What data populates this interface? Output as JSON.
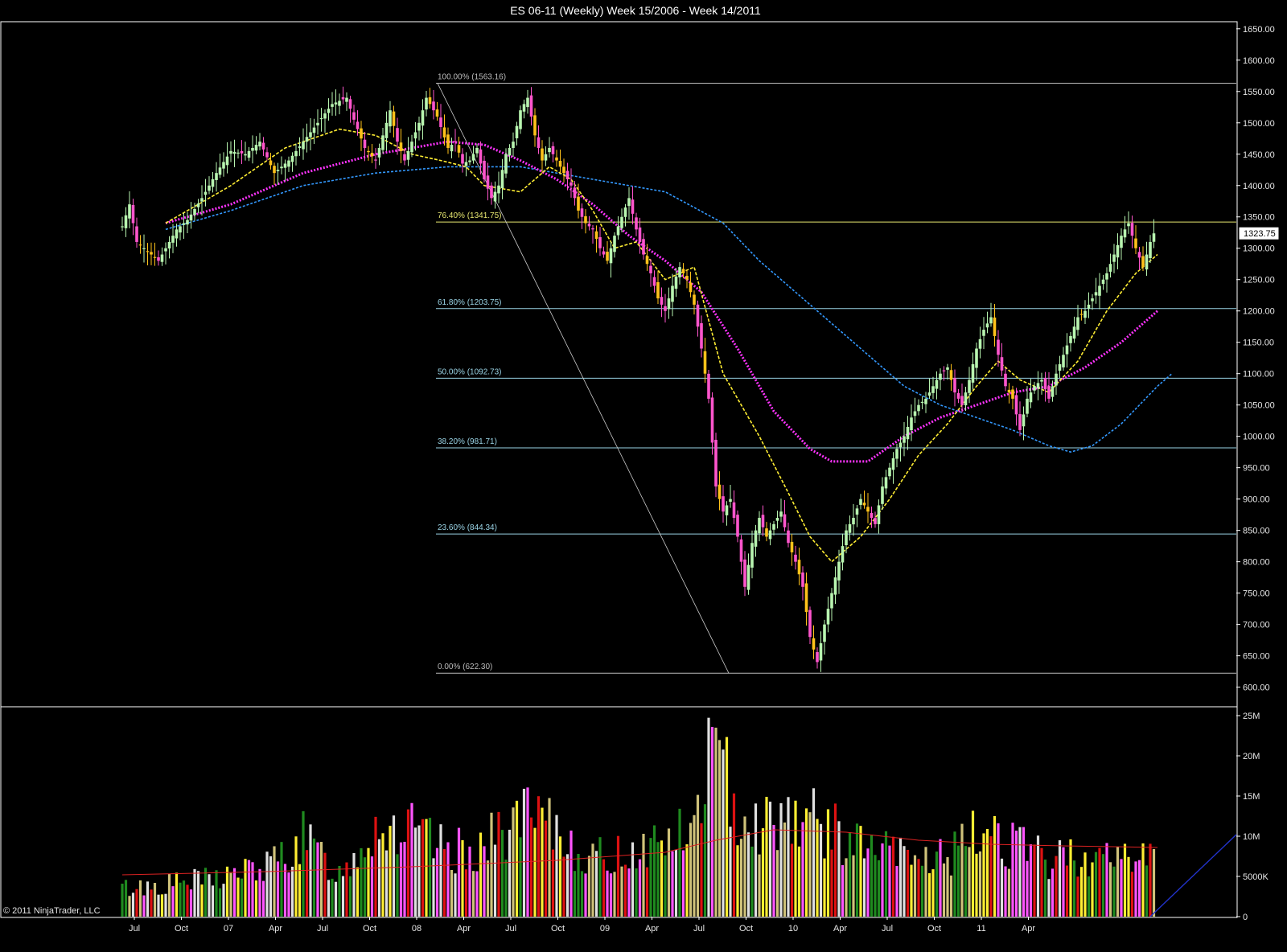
{
  "chart_data": {
    "type": "candlestick",
    "title": "ES 06-11 (Weekly)  Week 15/2006 - Week 14/2011",
    "copyright": "© 2011 NinjaTrader, LLC",
    "last_price": "1323.75",
    "colors": {
      "background": "#000000",
      "grid_frame": "#ffffff",
      "up_candle": "#b8f5b0",
      "down_candle_magenta": "#ff55cc",
      "down_candle_yellow": "#ffc21a",
      "ma_fast": "#ffee33",
      "ma_mid": "#ff33ff",
      "ma_slow": "#3399ff",
      "fib_764": "#e8e870",
      "fib_other": "#9ad4e6",
      "vol_ma": "#dd2222",
      "trendline": "#2233cc"
    },
    "price_panel": {
      "ylim": [
        570,
        1660
      ],
      "ticks": [
        "1650.00",
        "1600.00",
        "1550.00",
        "1500.00",
        "1450.00",
        "1400.00",
        "1350.00",
        "1300.00",
        "1250.00",
        "1200.00",
        "1150.00",
        "1100.00",
        "1050.00",
        "1000.00",
        "950.00",
        "900.00",
        "850.00",
        "800.00",
        "750.00",
        "700.00",
        "650.00",
        "600.00"
      ],
      "tick_values": [
        1650,
        1600,
        1550,
        1500,
        1450,
        1400,
        1350,
        1300,
        1250,
        1200,
        1150,
        1100,
        1050,
        1000,
        950,
        900,
        850,
        800,
        750,
        700,
        650,
        600
      ]
    },
    "volume_panel": {
      "ylim": [
        0,
        26
      ],
      "ticks": [
        "25M",
        "20M",
        "15M",
        "10M",
        "5000K",
        "0"
      ],
      "tick_values": [
        25,
        20,
        15,
        10,
        5,
        0
      ]
    },
    "x_axis": {
      "labels": [
        "Jul",
        "Oct",
        "07",
        "Apr",
        "Jul",
        "Oct",
        "08",
        "Apr",
        "Jul",
        "Oct",
        "09",
        "Apr",
        "Jul",
        "Oct",
        "10",
        "Apr",
        "Jul",
        "Oct",
        "11",
        "Apr"
      ],
      "weeks": [
        -10,
        3,
        16,
        29,
        42,
        55,
        68,
        81,
        94,
        107,
        120,
        133,
        146,
        159,
        172,
        185,
        198,
        211,
        224,
        237
      ]
    },
    "fibonacci": [
      {
        "label": "100.00% (1563.16)",
        "value": 1563.16
      },
      {
        "label": "76.40% (1341.75)",
        "value": 1341.75
      },
      {
        "label": "61.80% (1203.75)",
        "value": 1203.75
      },
      {
        "label": "50.00% (1092.73)",
        "value": 1092.73
      },
      {
        "label": "38.20% (981.71)",
        "value": 981.71
      },
      {
        "label": "23.60% (844.34)",
        "value": 844.34
      },
      {
        "label": "0.00% (622.30)",
        "value": 622.3
      }
    ],
    "close_anchors": [
      [
        0,
        1335
      ],
      [
        2,
        1370
      ],
      [
        4,
        1310
      ],
      [
        6,
        1300
      ],
      [
        8,
        1290
      ],
      [
        10,
        1280
      ],
      [
        12,
        1300
      ],
      [
        15,
        1330
      ],
      [
        18,
        1345
      ],
      [
        22,
        1380
      ],
      [
        26,
        1420
      ],
      [
        30,
        1455
      ],
      [
        34,
        1450
      ],
      [
        38,
        1470
      ],
      [
        42,
        1420
      ],
      [
        46,
        1440
      ],
      [
        50,
        1470
      ],
      [
        54,
        1500
      ],
      [
        58,
        1530
      ],
      [
        62,
        1540
      ],
      [
        64,
        1505
      ],
      [
        67,
        1460
      ],
      [
        70,
        1440
      ],
      [
        72,
        1480
      ],
      [
        74,
        1520
      ],
      [
        76,
        1470
      ],
      [
        78,
        1440
      ],
      [
        80,
        1470
      ],
      [
        82,
        1500
      ],
      [
        84,
        1540
      ],
      [
        87,
        1510
      ],
      [
        90,
        1460
      ],
      [
        92,
        1470
      ],
      [
        94,
        1435
      ],
      [
        96,
        1440
      ],
      [
        98,
        1460
      ],
      [
        100,
        1410
      ],
      [
        102,
        1380
      ],
      [
        104,
        1400
      ],
      [
        106,
        1450
      ],
      [
        108,
        1470
      ],
      [
        110,
        1520
      ],
      [
        112,
        1540
      ],
      [
        114,
        1480
      ],
      [
        116,
        1440
      ],
      [
        118,
        1460
      ],
      [
        120,
        1440
      ],
      [
        122,
        1420
      ],
      [
        124,
        1400
      ],
      [
        126,
        1360
      ],
      [
        128,
        1340
      ],
      [
        130,
        1330
      ],
      [
        132,
        1300
      ],
      [
        134,
        1280
      ],
      [
        136,
        1320
      ],
      [
        138,
        1350
      ],
      [
        140,
        1380
      ],
      [
        142,
        1330
      ],
      [
        144,
        1290
      ],
      [
        146,
        1260
      ],
      [
        148,
        1220
      ],
      [
        150,
        1200
      ],
      [
        152,
        1240
      ],
      [
        154,
        1270
      ],
      [
        156,
        1250
      ],
      [
        158,
        1210
      ],
      [
        160,
        1140
      ],
      [
        162,
        1060
      ],
      [
        164,
        920
      ],
      [
        166,
        880
      ],
      [
        168,
        900
      ],
      [
        170,
        840
      ],
      [
        172,
        760
      ],
      [
        174,
        830
      ],
      [
        176,
        870
      ],
      [
        178,
        840
      ],
      [
        180,
        860
      ],
      [
        182,
        880
      ],
      [
        184,
        830
      ],
      [
        186,
        800
      ],
      [
        188,
        760
      ],
      [
        190,
        680
      ],
      [
        192,
        640
      ],
      [
        194,
        700
      ],
      [
        196,
        750
      ],
      [
        198,
        800
      ],
      [
        200,
        850
      ],
      [
        202,
        870
      ],
      [
        204,
        900
      ],
      [
        206,
        880
      ],
      [
        208,
        860
      ],
      [
        210,
        920
      ],
      [
        212,
        950
      ],
      [
        214,
        980
      ],
      [
        216,
        1000
      ],
      [
        218,
        1030
      ],
      [
        220,
        1050
      ],
      [
        222,
        1060
      ],
      [
        224,
        1080
      ],
      [
        226,
        1100
      ],
      [
        228,
        1110
      ],
      [
        230,
        1070
      ],
      [
        232,
        1050
      ],
      [
        234,
        1090
      ],
      [
        236,
        1140
      ],
      [
        238,
        1170
      ],
      [
        240,
        1190
      ],
      [
        242,
        1130
      ],
      [
        244,
        1080
      ],
      [
        246,
        1060
      ],
      [
        248,
        1010
      ],
      [
        250,
        1060
      ],
      [
        252,
        1080
      ],
      [
        254,
        1090
      ],
      [
        256,
        1060
      ],
      [
        258,
        1100
      ],
      [
        260,
        1130
      ],
      [
        262,
        1160
      ],
      [
        264,
        1190
      ],
      [
        266,
        1200
      ],
      [
        268,
        1220
      ],
      [
        270,
        1240
      ],
      [
        272,
        1260
      ],
      [
        274,
        1290
      ],
      [
        276,
        1320
      ],
      [
        278,
        1340
      ],
      [
        280,
        1300
      ],
      [
        282,
        1270
      ],
      [
        284,
        1310
      ],
      [
        285,
        1323.75
      ]
    ],
    "ma_fast": [
      [
        12,
        1340
      ],
      [
        30,
        1400
      ],
      [
        45,
        1460
      ],
      [
        60,
        1490
      ],
      [
        70,
        1480
      ],
      [
        80,
        1450
      ],
      [
        88,
        1440
      ],
      [
        95,
        1430
      ],
      [
        100,
        1400
      ],
      [
        110,
        1390
      ],
      [
        118,
        1430
      ],
      [
        124,
        1410
      ],
      [
        130,
        1360
      ],
      [
        136,
        1300
      ],
      [
        142,
        1310
      ],
      [
        150,
        1250
      ],
      [
        158,
        1270
      ],
      [
        166,
        1100
      ],
      [
        176,
        1000
      ],
      [
        184,
        910
      ],
      [
        190,
        840
      ],
      [
        196,
        800
      ],
      [
        204,
        840
      ],
      [
        212,
        900
      ],
      [
        220,
        970
      ],
      [
        228,
        1020
      ],
      [
        236,
        1080
      ],
      [
        242,
        1120
      ],
      [
        248,
        1090
      ],
      [
        256,
        1070
      ],
      [
        264,
        1120
      ],
      [
        272,
        1200
      ],
      [
        280,
        1260
      ],
      [
        286,
        1290
      ]
    ],
    "ma_mid": [
      [
        12,
        1340
      ],
      [
        30,
        1370
      ],
      [
        50,
        1420
      ],
      [
        70,
        1450
      ],
      [
        90,
        1470
      ],
      [
        100,
        1465
      ],
      [
        110,
        1440
      ],
      [
        120,
        1410
      ],
      [
        130,
        1370
      ],
      [
        140,
        1320
      ],
      [
        150,
        1280
      ],
      [
        160,
        1230
      ],
      [
        170,
        1140
      ],
      [
        180,
        1040
      ],
      [
        190,
        980
      ],
      [
        196,
        960
      ],
      [
        206,
        960
      ],
      [
        216,
        1000
      ],
      [
        226,
        1030
      ],
      [
        236,
        1050
      ],
      [
        246,
        1070
      ],
      [
        256,
        1080
      ],
      [
        266,
        1110
      ],
      [
        276,
        1150
      ],
      [
        286,
        1200
      ]
    ],
    "ma_slow": [
      [
        12,
        1330
      ],
      [
        30,
        1360
      ],
      [
        50,
        1400
      ],
      [
        70,
        1420
      ],
      [
        90,
        1430
      ],
      [
        110,
        1430
      ],
      [
        130,
        1410
      ],
      [
        150,
        1390
      ],
      [
        166,
        1340
      ],
      [
        176,
        1280
      ],
      [
        186,
        1230
      ],
      [
        196,
        1180
      ],
      [
        206,
        1130
      ],
      [
        216,
        1080
      ],
      [
        226,
        1050
      ],
      [
        236,
        1030
      ],
      [
        246,
        1010
      ],
      [
        256,
        985
      ],
      [
        262,
        975
      ],
      [
        268,
        985
      ],
      [
        276,
        1020
      ],
      [
        286,
        1080
      ],
      [
        290,
        1100
      ]
    ],
    "volume_anchors": [
      [
        0,
        4
      ],
      [
        20,
        5
      ],
      [
        40,
        7
      ],
      [
        50,
        11
      ],
      [
        60,
        6
      ],
      [
        70,
        13
      ],
      [
        80,
        12
      ],
      [
        90,
        9
      ],
      [
        100,
        10
      ],
      [
        110,
        14
      ],
      [
        120,
        12
      ],
      [
        130,
        8
      ],
      [
        138,
        9
      ],
      [
        144,
        10
      ],
      [
        150,
        11
      ],
      [
        158,
        12
      ],
      [
        162,
        24
      ],
      [
        164,
        22
      ],
      [
        170,
        16
      ],
      [
        176,
        13
      ],
      [
        184,
        15
      ],
      [
        190,
        14
      ],
      [
        196,
        12
      ],
      [
        204,
        10
      ],
      [
        212,
        9
      ],
      [
        220,
        8
      ],
      [
        230,
        9
      ],
      [
        240,
        13
      ],
      [
        244,
        11
      ],
      [
        250,
        9
      ],
      [
        256,
        8
      ],
      [
        264,
        9
      ],
      [
        272,
        8
      ],
      [
        280,
        9
      ],
      [
        285,
        8
      ]
    ],
    "vol_ma": [
      [
        0,
        5.2
      ],
      [
        40,
        5.6
      ],
      [
        80,
        6.2
      ],
      [
        120,
        7
      ],
      [
        150,
        8
      ],
      [
        164,
        9.5
      ],
      [
        180,
        10.8
      ],
      [
        200,
        10.5
      ],
      [
        220,
        9.5
      ],
      [
        240,
        9
      ],
      [
        260,
        8.8
      ],
      [
        286,
        8.6
      ]
    ]
  }
}
